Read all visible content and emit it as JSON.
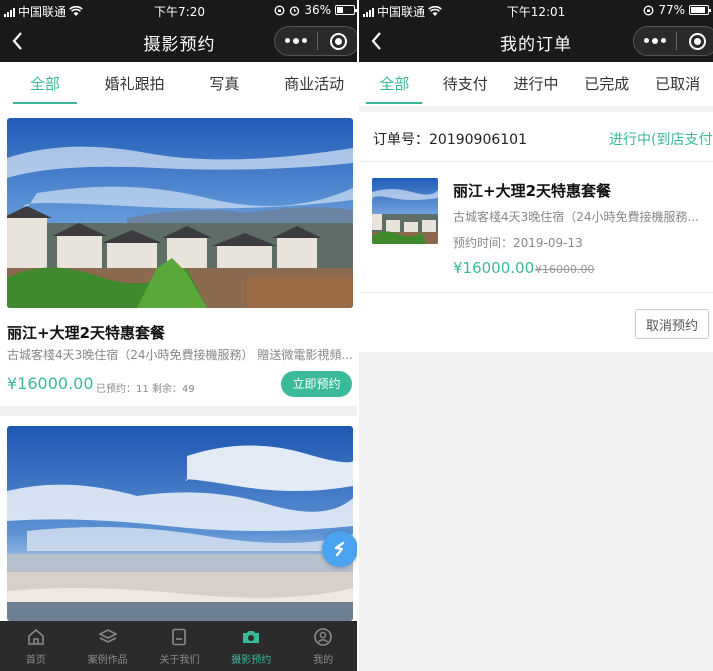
{
  "left": {
    "status": {
      "carrier": "中国联通",
      "time": "下午7:20",
      "battery": "36%",
      "battery_level": 0.36
    },
    "nav": {
      "title": "摄影预约"
    },
    "tabs": [
      {
        "label": "全部",
        "active": true
      },
      {
        "label": "婚礼跟拍"
      },
      {
        "label": "写真"
      },
      {
        "label": "商业活动"
      }
    ],
    "cards": [
      {
        "title": "丽江+大理2天特惠套餐",
        "desc": "古城客棧4天3晚住宿（24小時免費接機服務） 贈送微電影視頻...",
        "price": "¥16000.00",
        "meta": "已预约：11  剩余：49",
        "button": "立即预约"
      }
    ],
    "bottom_nav": [
      {
        "label": "首页",
        "icon": "home-icon"
      },
      {
        "label": "案例作品",
        "icon": "layers-icon"
      },
      {
        "label": "关于我们",
        "icon": "document-icon"
      },
      {
        "label": "摄影预约",
        "icon": "camera-icon",
        "active": true
      },
      {
        "label": "我的",
        "icon": "user-icon"
      }
    ]
  },
  "right": {
    "status": {
      "carrier": "中国联通",
      "time": "下午12:01",
      "battery": "77%",
      "battery_level": 0.77
    },
    "nav": {
      "title": "我的订单"
    },
    "tabs": [
      {
        "label": "全部",
        "active": true
      },
      {
        "label": "待支付"
      },
      {
        "label": "进行中"
      },
      {
        "label": "已完成"
      },
      {
        "label": "已取消"
      }
    ],
    "order": {
      "number": "订单号：20190906101",
      "status": "进行中(到店支付)",
      "title": "丽江+大理2天特惠套餐",
      "desc": "古城客棧4天3晚住宿（24小時免費接機服務...",
      "time": "预约时间：2019-09-13",
      "price": "¥16000.00",
      "original_price": "¥16000.00",
      "cancel": "取消预约"
    }
  },
  "colors": {
    "accent": "#3bb99b",
    "nav_bg": "#191919",
    "bottom_bg": "#2b2b2b",
    "float": "#4aa3f0"
  }
}
